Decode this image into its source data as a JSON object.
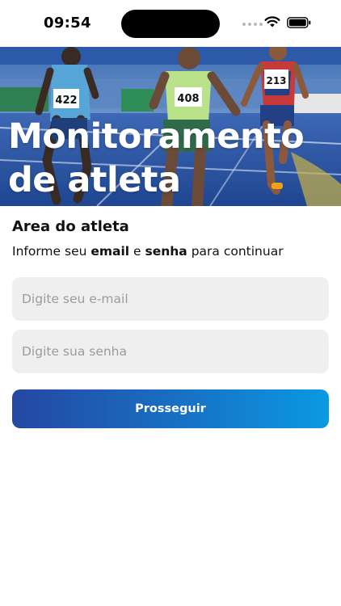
{
  "status_bar": {
    "time": "09:54"
  },
  "hero": {
    "title": "Monitoramento\nde atleta",
    "image": "photo of sprinters racing on a blue running track"
  },
  "login": {
    "heading": "Area do atleta",
    "subtitle_parts": [
      "Informe seu ",
      "email",
      " e ",
      "senha",
      " para continuar"
    ],
    "email_placeholder": "Digite seu e-mail",
    "password_placeholder": "Digite sua senha",
    "submit_label": "Prosseguir"
  },
  "icons": {
    "wifi": "wifi-icon",
    "battery": "battery-icon",
    "signal": "cellular-signal-icon"
  },
  "colors": {
    "button_gradient_start": "#2448a2",
    "button_gradient_end": "#0a9ae2",
    "field_background": "#efefef",
    "placeholder": "#9b9b9b",
    "track_blue": "#2b56a8"
  }
}
